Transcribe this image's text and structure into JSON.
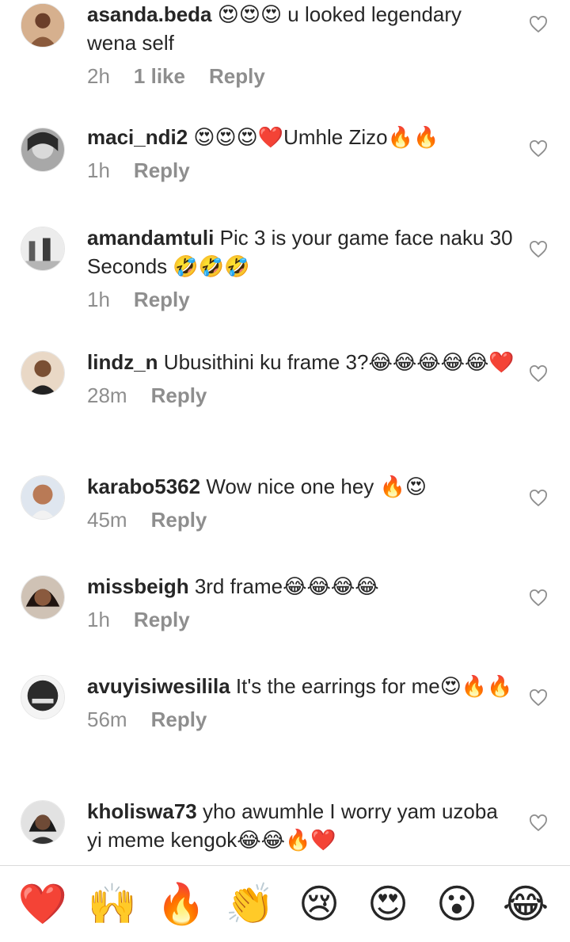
{
  "comments": [
    {
      "username": "asanda.beda",
      "emoji_before": "😍😍😍",
      "text": " u looked legendary wena self",
      "time": "2h",
      "likes": "1 like",
      "reply": "Reply",
      "avatar_color": "#b07a5a"
    },
    {
      "username": "maci_ndi2",
      "emoji_before": "😍😍😍❤️",
      "text": "Umhle Zizo🔥🔥",
      "time": "1h",
      "likes": "",
      "reply": "Reply",
      "avatar_color": "#8c8c8c"
    },
    {
      "username": "amandamtuli",
      "emoji_before": "",
      "text": " Pic 3 is your game face naku 30 Seconds 🤣🤣🤣",
      "time": "1h",
      "likes": "",
      "reply": "Reply",
      "avatar_color": "#c9c9c9"
    },
    {
      "username": "lindz_n",
      "emoji_before": "",
      "text": " Ubusithini ku frame 3?😂😂😂😂😂❤️",
      "time": "28m",
      "likes": "",
      "reply": "Reply",
      "avatar_color": "#6b4a32"
    },
    {
      "username": "karabo5362",
      "emoji_before": "",
      "text": " Wow nice one hey 🔥😍",
      "time": "45m",
      "likes": "",
      "reply": "Reply",
      "avatar_color": "#c98c6b"
    },
    {
      "username": "missbeigh",
      "emoji_before": "",
      "text": " 3rd frame😂😂😂😂",
      "time": "1h",
      "likes": "",
      "reply": "Reply",
      "avatar_color": "#4a2f24"
    },
    {
      "username": "avuyisiwesilila",
      "emoji_before": "",
      "text": " It's the earrings for me😍🔥🔥",
      "time": "56m",
      "likes": "",
      "reply": "Reply",
      "avatar_color": "#2b2b2b"
    },
    {
      "username": "kholiswa73",
      "emoji_before": "",
      "text": " yho awumhle I worry yam uzoba yi meme kengok😂😂🔥❤️",
      "time": "1h",
      "likes": "",
      "reply": "Reply",
      "avatar_color": "#3d3d3d"
    }
  ],
  "reactions": [
    {
      "emoji": "❤️",
      "icon": "red-heart-icon"
    },
    {
      "emoji": "🙌",
      "icon": "raising-hands-icon"
    },
    {
      "emoji": "🔥",
      "icon": "fire-icon"
    },
    {
      "emoji": "👏",
      "icon": "clapping-hands-icon"
    },
    {
      "emoji": "😢",
      "icon": "crying-face-icon"
    },
    {
      "emoji": "😍",
      "icon": "heart-eyes-icon"
    },
    {
      "emoji": "😮",
      "icon": "surprised-face-icon"
    },
    {
      "emoji": "😂",
      "icon": "tears-of-joy-icon"
    }
  ],
  "colors": {
    "text": "#262626",
    "meta": "#8e8e8e",
    "divider": "#dbdbdb"
  }
}
